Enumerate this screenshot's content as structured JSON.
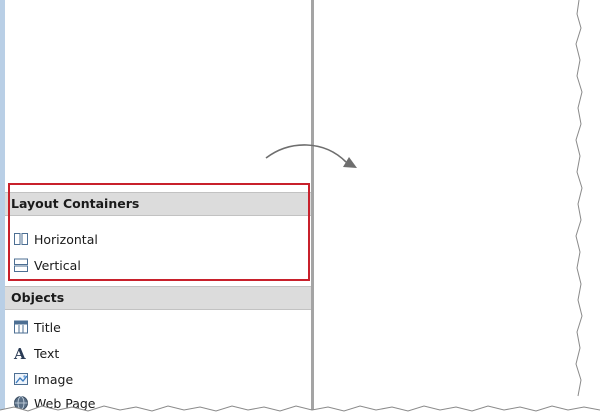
{
  "sections": {
    "layout_containers": {
      "label": "Layout Containers",
      "items": [
        {
          "label": "Horizontal",
          "icon": "horizontal-layout-icon"
        },
        {
          "label": "Vertical",
          "icon": "vertical-layout-icon"
        }
      ]
    },
    "objects": {
      "label": "Objects",
      "items": [
        {
          "label": "Title",
          "icon": "title-icon"
        },
        {
          "label": "Text",
          "icon": "text-icon"
        },
        {
          "label": "Image",
          "icon": "image-icon"
        },
        {
          "label": "Web Page",
          "icon": "web-page-icon"
        }
      ]
    }
  },
  "colors": {
    "highlight_border": "#c8202b",
    "section_header_bg": "#dcdcdc",
    "accent_strip": "#b9cfe6",
    "divider": "#a4a4a4"
  }
}
